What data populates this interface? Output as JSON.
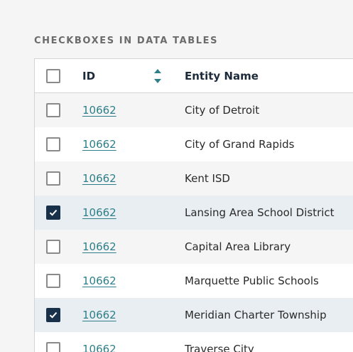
{
  "section": {
    "title": "CHECKBOXES IN DATA TABLES"
  },
  "table": {
    "columns": {
      "id": "ID",
      "entity_name": "Entity Name"
    },
    "rows": [
      {
        "id": "10662",
        "entity": "City of Detroit",
        "checked": false
      },
      {
        "id": "10662",
        "entity": "City of Grand Rapids",
        "checked": false
      },
      {
        "id": "10662",
        "entity": "Kent ISD",
        "checked": false
      },
      {
        "id": "10662",
        "entity": "Lansing Area School District",
        "checked": true
      },
      {
        "id": "10662",
        "entity": "Capital Area Library",
        "checked": false
      },
      {
        "id": "10662",
        "entity": "Marquette Public Schools",
        "checked": false
      },
      {
        "id": "10662",
        "entity": "Meridian Charter Township",
        "checked": true
      },
      {
        "id": "10662",
        "entity": "Traverse City",
        "checked": false
      }
    ]
  },
  "colors": {
    "checked": "#18304a",
    "link": "#2e7f88",
    "selected_row": "#e8eef2",
    "alt_row": "#f5f5f5"
  },
  "icons": {
    "sort": "sort-up-down-icon",
    "check": "checkmark-icon"
  }
}
